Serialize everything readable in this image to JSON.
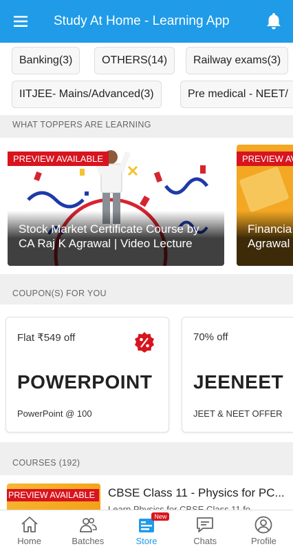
{
  "appbar": {
    "title": "Study At Home - Learning App"
  },
  "categories": [
    "Banking(3)",
    "OTHERS(14)",
    "Railway exams(3)",
    "IITJEE- Mains/Advanced(3)",
    "Pre medical - NEET/"
  ],
  "toppers": {
    "label": "WHAT TOPPERS ARE LEARNING",
    "cards": [
      {
        "badge": "PREVIEW AVAILABLE",
        "title": "Stock Market Certificate Course by CA Raj K Agrawal | Video Lecture"
      },
      {
        "badge": "PREVIEW AVA",
        "title": "Financia Agrawal"
      }
    ]
  },
  "coupons": {
    "label": "COUPON(S) FOR YOU",
    "items": [
      {
        "off": "Flat ₹549 off",
        "code": "POWERPOINT",
        "desc": "PowerPoint @ 100",
        "icon": "percent-badge-icon"
      },
      {
        "off": "70% off",
        "code": "JEENEET",
        "desc": "JEET & NEET OFFER"
      }
    ]
  },
  "courses": {
    "label": "COURSES (192)",
    "first": {
      "badge": "PREVIEW AVAILABLE",
      "title": "CBSE Class 11 - Physics for PC...",
      "sub": "Learn Physics for CBSE Class 11 fo"
    }
  },
  "nav": {
    "items": [
      {
        "label": "Home",
        "icon": "home-icon"
      },
      {
        "label": "Batches",
        "icon": "batches-icon"
      },
      {
        "label": "Store",
        "icon": "store-icon",
        "badge": "New"
      },
      {
        "label": "Chats",
        "icon": "chat-icon"
      },
      {
        "label": "Profile",
        "icon": "profile-icon"
      }
    ]
  },
  "colors": {
    "primary": "#1f9be8",
    "badge": "#d8141e"
  }
}
